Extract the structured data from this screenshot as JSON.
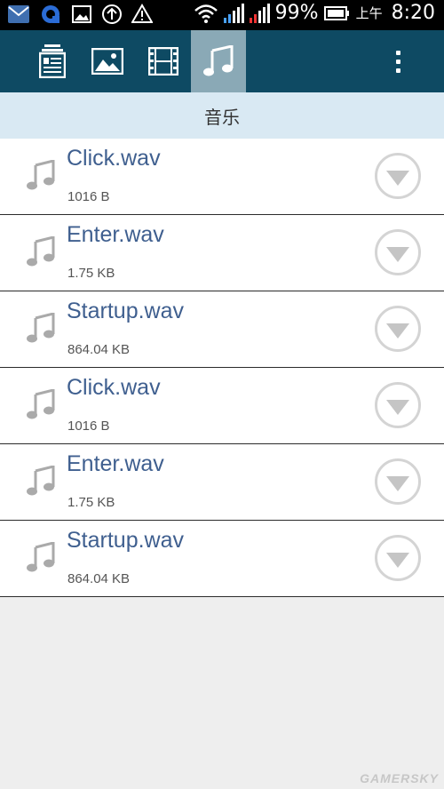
{
  "status_bar": {
    "battery_percent": "99%",
    "ampm": "上午",
    "time": "8:20",
    "icons": [
      "mail-icon",
      "sync-icon",
      "image-icon",
      "upload-icon",
      "warning-icon",
      "wifi-icon",
      "signal-icon",
      "signal-noservice-icon",
      "battery-icon"
    ]
  },
  "toolbar": {
    "tabs": [
      {
        "icon": "document-icon",
        "active": false
      },
      {
        "icon": "image-icon",
        "active": false
      },
      {
        "icon": "video-icon",
        "active": false
      },
      {
        "icon": "music-icon",
        "active": true
      }
    ],
    "menu_icon": "overflow-menu-icon"
  },
  "section": {
    "title": "音乐"
  },
  "files": [
    {
      "name": "Click.wav",
      "size": "1016 B"
    },
    {
      "name": "Enter.wav",
      "size": "1.75 KB"
    },
    {
      "name": "Startup.wav",
      "size": "864.04 KB"
    },
    {
      "name": "Click.wav",
      "size": "1016 B"
    },
    {
      "name": "Enter.wav",
      "size": "1.75 KB"
    },
    {
      "name": "Startup.wav",
      "size": "864.04 KB"
    }
  ],
  "watermark": "GAMERSKY",
  "colors": {
    "toolbar": "#0e4a63",
    "active_tab": "#8aa9b6",
    "section_bg": "#d9e9f3",
    "file_name": "#3f5f8f"
  }
}
